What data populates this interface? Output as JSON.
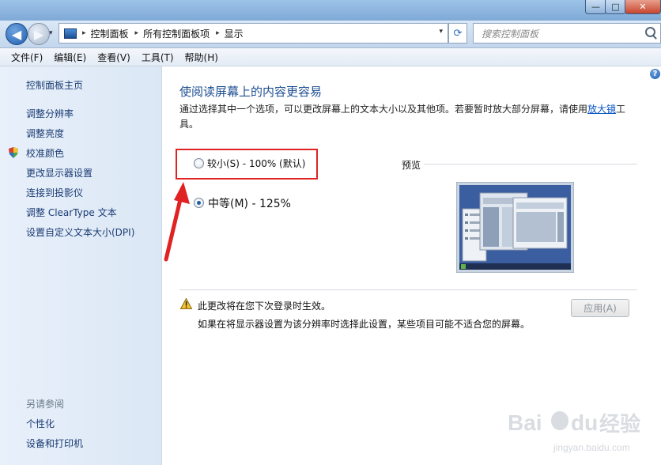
{
  "window": {
    "min_glyph": "—",
    "max_glyph": "□",
    "close_glyph": "✕"
  },
  "address": {
    "history_glyph": "▾",
    "breadcrumbs": [
      "控制面板",
      "所有控制面板项",
      "显示"
    ],
    "separator": "▸",
    "dropdown_glyph": "▾",
    "refresh_glyph": "⟳"
  },
  "search": {
    "placeholder": "搜索控制面板"
  },
  "menu": [
    "文件(F)",
    "编辑(E)",
    "查看(V)",
    "工具(T)",
    "帮助(H)"
  ],
  "sidebar": {
    "home": "控制面板主页",
    "items": [
      "调整分辨率",
      "调整亮度",
      "校准颜色",
      "更改显示器设置",
      "连接到投影仪",
      "调整 ClearType 文本",
      "设置自定义文本大小(DPI)"
    ],
    "see_also_title": "另请参阅",
    "see_also": [
      "个性化",
      "设备和打印机"
    ]
  },
  "main": {
    "help_glyph": "?",
    "title": "使阅读屏幕上的内容更容易",
    "description_before": "通过选择其中一个选项，可以更改屏幕上的文本大小以及其他项。若要暂时放大部分屏幕，请使用",
    "description_link": "放大镜",
    "description_after": "工具。",
    "options": [
      {
        "label": "较小(S) - 100% (默认)",
        "selected": false
      },
      {
        "label": "中等(M) - 125%",
        "selected": true
      }
    ],
    "preview_label": "预览",
    "warning": "此更改将在您下次登录时生效。",
    "warning_detail": "如果在将显示器设置为该分辨率时选择此设置，某些项目可能不适合您的屏幕。",
    "apply_button": "应用(A)"
  },
  "watermark": {
    "logo": "Bai du 经验",
    "url": "jingyan.baidu.com"
  },
  "colors": {
    "link": "#1a3b73",
    "title": "#1d4f91",
    "highlight": "#e02222"
  }
}
